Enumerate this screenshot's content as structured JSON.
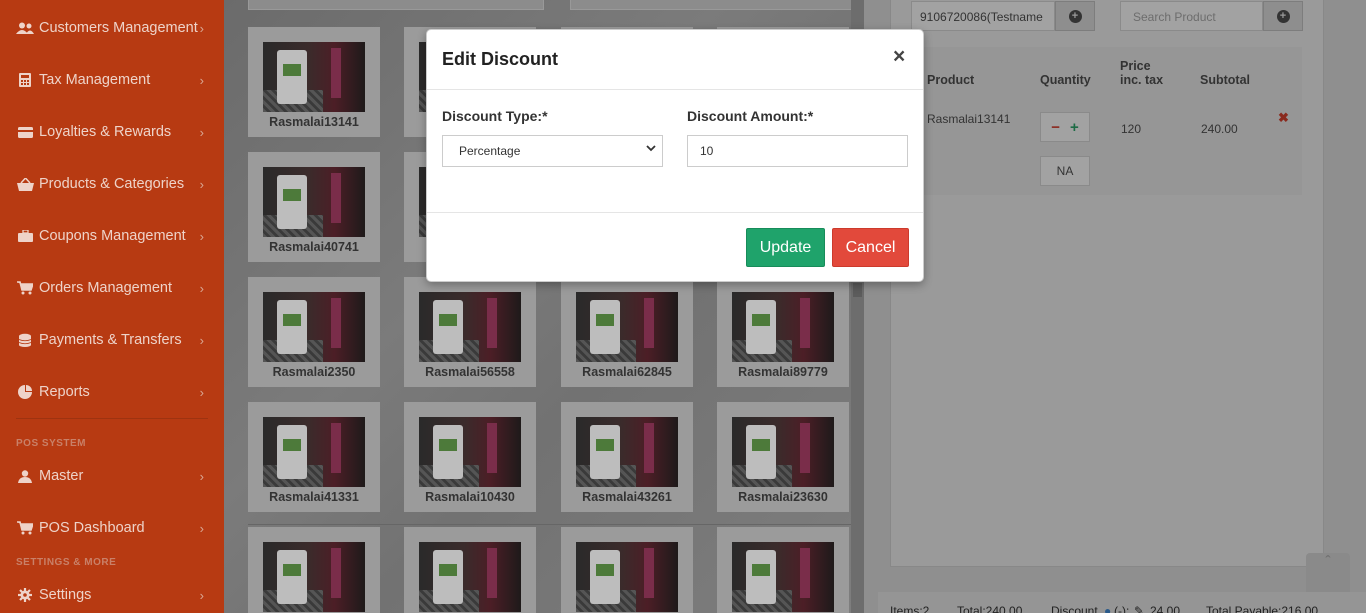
{
  "sidebar": {
    "items": [
      {
        "label": "Customers Management",
        "icon": "users-icon"
      },
      {
        "label": "Tax Management",
        "icon": "calculator-icon"
      },
      {
        "label": "Loyalties & Rewards",
        "icon": "credit-card-icon"
      },
      {
        "label": "Products & Categories",
        "icon": "basket-icon"
      },
      {
        "label": "Coupons Management",
        "icon": "briefcase-icon"
      },
      {
        "label": "Orders Management",
        "icon": "cart-icon"
      },
      {
        "label": "Payments & Transfers",
        "icon": "coins-icon"
      },
      {
        "label": "Reports",
        "icon": "pie-chart-icon"
      },
      {
        "label": "Master",
        "icon": "user-icon"
      },
      {
        "label": "POS Dashboard",
        "icon": "cart-icon"
      },
      {
        "label": "Settings",
        "icon": "gear-icon"
      }
    ],
    "section_pos": "POS SYSTEM",
    "section_settings": "SETTINGS & MORE"
  },
  "products": [
    "Rasmalai13141",
    "",
    "",
    "",
    "Rasmalai40741",
    "",
    "",
    "",
    "Rasmalai2350",
    "Rasmalai56558",
    "Rasmalai62845",
    "Rasmalai89779",
    "Rasmalai41331",
    "Rasmalai10430",
    "Rasmalai43261",
    "Rasmalai23630",
    "",
    "",
    "",
    ""
  ],
  "cart": {
    "customer_value": "9106720086(Testname",
    "search_placeholder": "Search Product",
    "headers": {
      "product": "Product",
      "quantity": "Quantity",
      "price_line1": "Price",
      "price_line2": "inc. tax",
      "subtotal": "Subtotal"
    },
    "row": {
      "product": "Rasmalai13141",
      "minus": "−",
      "plus": "+",
      "price": "120",
      "subtotal": "240.00",
      "note": "NA",
      "remove": "✖"
    },
    "footer": {
      "items": "Items:2",
      "total": "Total:240.00",
      "discount": "Discount",
      "discount_sign": "(-):",
      "discount_value": "24.00",
      "payable": "Total Payable:216.00"
    }
  },
  "modal": {
    "title": "Edit Discount",
    "close": "×",
    "type_label": "Discount Type:*",
    "type_value": "Percentage",
    "amount_label": "Discount Amount:*",
    "amount_value": "10",
    "update": "Update",
    "cancel": "Cancel"
  },
  "colors": {
    "sidebar_bg": "#b73a12",
    "update_btn": "#1fa36b",
    "cancel_btn": "#e2493b"
  }
}
